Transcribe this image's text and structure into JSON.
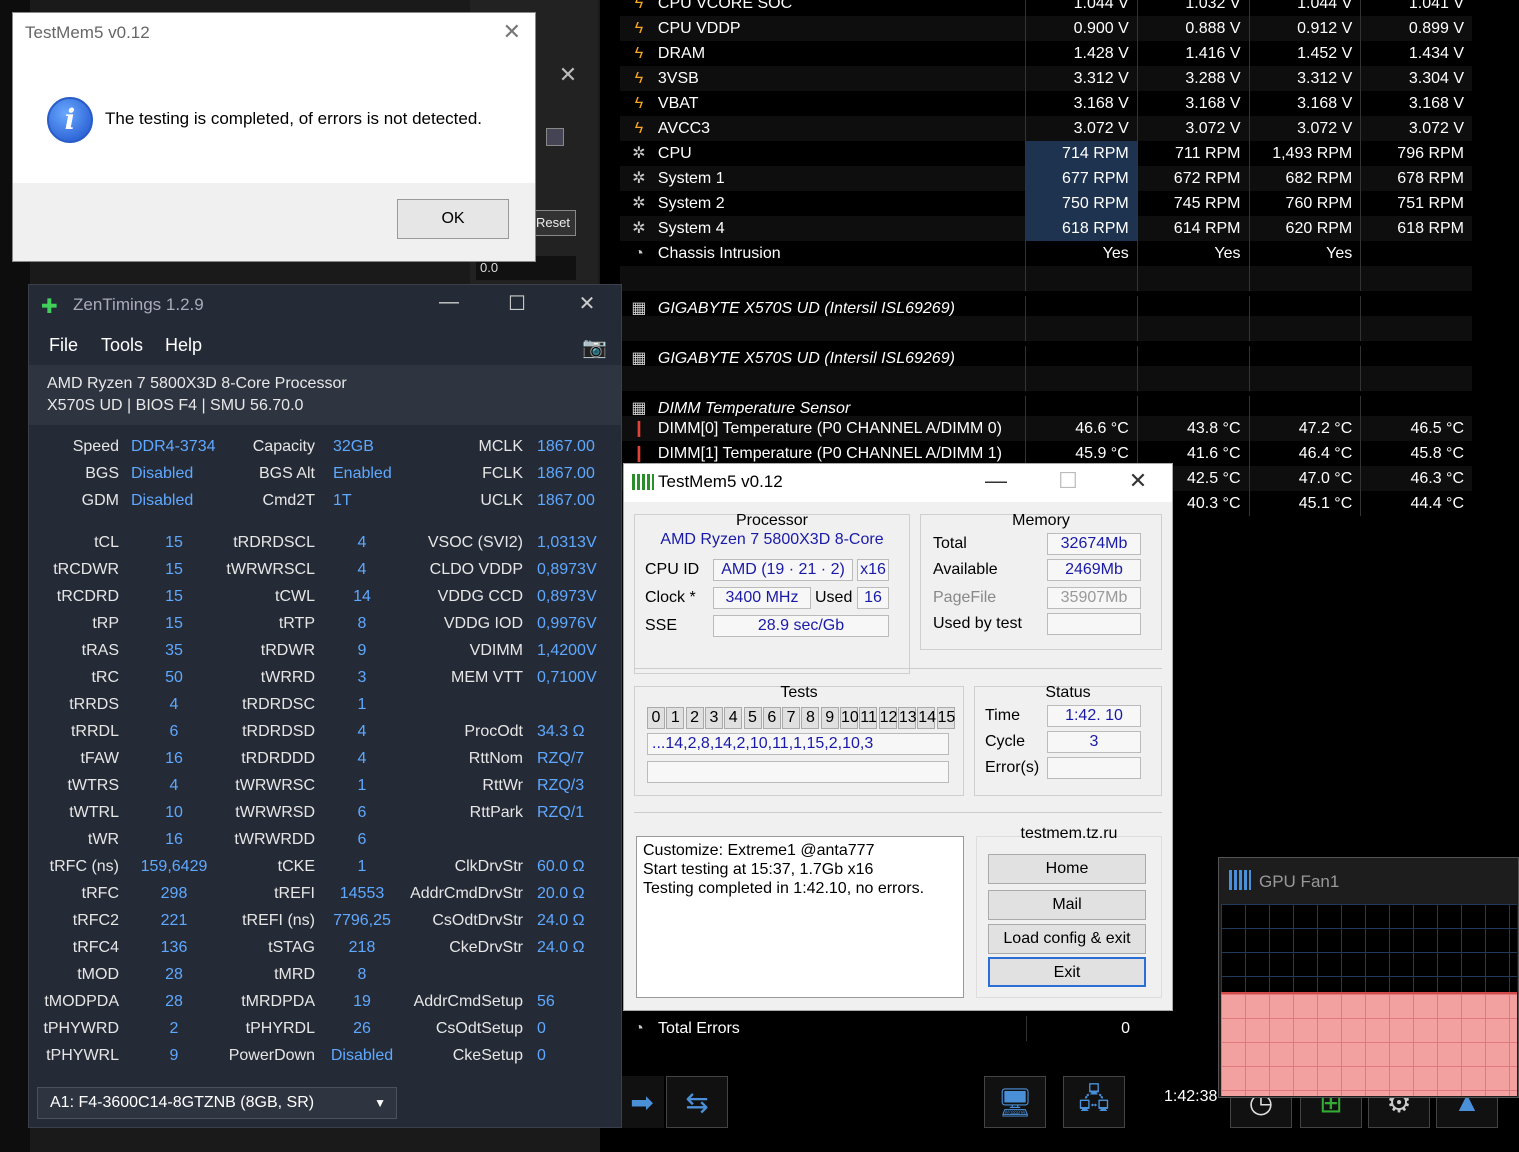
{
  "dialog": {
    "title": "TestMem5 v0.12",
    "message": "The testing is completed, of errors is not detected.",
    "ok_label": "OK"
  },
  "bg_window": {
    "reset_label": "Reset",
    "value": "0.0"
  },
  "sensor": {
    "rows": [
      {
        "icon": "bolt-icon",
        "name": "CPU VCORE SOC",
        "v": [
          "1.044 V",
          "1.032 V",
          "1.044 V",
          "1.041 V"
        ]
      },
      {
        "icon": "bolt-icon",
        "name": "CPU VDDP",
        "v": [
          "0.900 V",
          "0.888 V",
          "0.912 V",
          "0.899 V"
        ]
      },
      {
        "icon": "bolt-icon",
        "name": "DRAM",
        "v": [
          "1.428 V",
          "1.416 V",
          "1.452 V",
          "1.434 V"
        ]
      },
      {
        "icon": "bolt-icon",
        "name": "3VSB",
        "v": [
          "3.312 V",
          "3.288 V",
          "3.312 V",
          "3.304 V"
        ]
      },
      {
        "icon": "bolt-icon",
        "name": "VBAT",
        "v": [
          "3.168 V",
          "3.168 V",
          "3.168 V",
          "3.168 V"
        ]
      },
      {
        "icon": "bolt-icon",
        "name": "AVCC3",
        "v": [
          "3.072 V",
          "3.072 V",
          "3.072 V",
          "3.072 V"
        ]
      },
      {
        "icon": "fan-icon",
        "name": "CPU",
        "v": [
          "714 RPM",
          "711 RPM",
          "1,493 RPM",
          "796 RPM"
        ],
        "hl": true
      },
      {
        "icon": "fan-icon",
        "name": "System 1",
        "v": [
          "677 RPM",
          "672 RPM",
          "682 RPM",
          "678 RPM"
        ],
        "hl": true
      },
      {
        "icon": "fan-icon",
        "name": "System 2",
        "v": [
          "750 RPM",
          "745 RPM",
          "760 RPM",
          "751 RPM"
        ],
        "hl": true
      },
      {
        "icon": "fan-icon",
        "name": "System 4",
        "v": [
          "618 RPM",
          "614 RPM",
          "620 RPM",
          "618 RPM"
        ],
        "hl": true
      },
      {
        "icon": "clock-icon",
        "name": "Chassis Intrusion",
        "v": [
          "Yes",
          "Yes",
          "Yes",
          ""
        ]
      },
      {
        "icon": "",
        "name": "",
        "v": [
          "",
          "",
          "",
          ""
        ]
      },
      {
        "icon": "chip-icon",
        "name": "GIGABYTE X570S UD (Intersil ISL69269)",
        "v": [
          "",
          "",
          "",
          ""
        ],
        "hdr": true
      },
      {
        "icon": "",
        "name": "",
        "v": [
          "",
          "",
          "",
          ""
        ]
      },
      {
        "icon": "chip-icon",
        "name": "GIGABYTE X570S UD (Intersil ISL69269)",
        "v": [
          "",
          "",
          "",
          ""
        ],
        "hdr": true
      },
      {
        "icon": "",
        "name": "",
        "v": [
          "",
          "",
          "",
          ""
        ]
      },
      {
        "icon": "chip-icon",
        "name": "DIMM Temperature Sensor",
        "v": [
          "",
          "",
          "",
          ""
        ],
        "hdr": true
      },
      {
        "icon": "thermo-icon",
        "name": "DIMM[0] Temperature (P0 CHANNEL A/DIMM 0)",
        "v": [
          "46.6 °C",
          "43.8 °C",
          "47.2 °C",
          "46.5 °C"
        ]
      },
      {
        "icon": "thermo-icon",
        "name": "DIMM[1] Temperature (P0 CHANNEL A/DIMM 1)",
        "v": [
          "45.9 °C",
          "41.6 °C",
          "46.4 °C",
          "45.8 °C"
        ]
      },
      {
        "icon": "",
        "name": "",
        "v": [
          "",
          "42.5 °C",
          "47.0 °C",
          "46.3 °C"
        ]
      },
      {
        "icon": "",
        "name": "",
        "v": [
          "",
          "40.3 °C",
          "45.1 °C",
          "44.4 °C"
        ]
      }
    ],
    "total_errors": {
      "name": "Total Errors",
      "value": "0"
    },
    "clock": "1:42:38"
  },
  "zen": {
    "title": "ZenTimings 1.2.9",
    "menu": [
      "File",
      "Tools",
      "Help"
    ],
    "cpu_line1": "AMD Ryzen 7 5800X3D 8-Core Processor",
    "cpu_line2": "X570S UD | BIOS F4 | SMU 56.70.0",
    "rows": [
      [
        "Speed",
        "DDR4-3734",
        "Capacity",
        "32GB",
        "MCLK",
        "1867.00"
      ],
      [
        "BGS",
        "Disabled",
        "BGS Alt",
        "Enabled",
        "FCLK",
        "1867.00"
      ],
      [
        "GDM",
        "Disabled",
        "Cmd2T",
        "1T",
        "UCLK",
        "1867.00"
      ],
      [
        "",
        "",
        "",
        "",
        "",
        ""
      ],
      [
        "tCL",
        "15",
        "tRDRDSCL",
        "4",
        "VSOC (SVI2)",
        "1,0313V"
      ],
      [
        "tRCDWR",
        "15",
        "tWRWRSCL",
        "4",
        "CLDO VDDP",
        "0,8973V"
      ],
      [
        "tRCDRD",
        "15",
        "tCWL",
        "14",
        "VDDG CCD",
        "0,8973V"
      ],
      [
        "tRP",
        "15",
        "tRTP",
        "8",
        "VDDG IOD",
        "0,9976V"
      ],
      [
        "tRAS",
        "35",
        "tRDWR",
        "9",
        "VDIMM",
        "1,4200V"
      ],
      [
        "tRC",
        "50",
        "tWRRD",
        "3",
        "MEM VTT",
        "0,7100V"
      ],
      [
        "tRRDS",
        "4",
        "tRDRDSC",
        "1",
        "",
        ""
      ],
      [
        "tRRDL",
        "6",
        "tRDRDSD",
        "4",
        "ProcOdt",
        "34.3 Ω"
      ],
      [
        "tFAW",
        "16",
        "tRDRDDD",
        "4",
        "RttNom",
        "RZQ/7"
      ],
      [
        "tWTRS",
        "4",
        "tWRWRSC",
        "1",
        "RttWr",
        "RZQ/3"
      ],
      [
        "tWTRL",
        "10",
        "tWRWRSD",
        "6",
        "RttPark",
        "RZQ/1"
      ],
      [
        "tWR",
        "16",
        "tWRWRDD",
        "6",
        "",
        ""
      ],
      [
        "tRFC (ns)",
        "159,6429",
        "tCKE",
        "1",
        "ClkDrvStr",
        "60.0 Ω"
      ],
      [
        "tRFC",
        "298",
        "tREFI",
        "14553",
        "AddrCmdDrvStr",
        "20.0 Ω"
      ],
      [
        "tRFC2",
        "221",
        "tREFI (ns)",
        "7796,25",
        "CsOdtDrvStr",
        "24.0 Ω"
      ],
      [
        "tRFC4",
        "136",
        "tSTAG",
        "218",
        "CkeDrvStr",
        "24.0 Ω"
      ],
      [
        "tMOD",
        "28",
        "tMRD",
        "8",
        "",
        ""
      ],
      [
        "tMODPDA",
        "28",
        "tMRDPDA",
        "19",
        "AddrCmdSetup",
        "56"
      ],
      [
        "tPHYWRD",
        "2",
        "tPHYRDL",
        "26",
        "CsOdtSetup",
        "0"
      ],
      [
        "tPHYWRL",
        "9",
        "PowerDown",
        "Disabled",
        "CkeSetup",
        "0"
      ]
    ],
    "dimm_select": "A1: F4-3600C14-8GTZNB (8GB, SR)"
  },
  "tm": {
    "title": "TestMem5 v0.12",
    "processor_title": "Processor",
    "processor_name": "AMD Ryzen 7 5800X3D 8-Core",
    "cpu_id_label": "CPU ID",
    "cpu_id_value": "AMD  (19 · 21 · 2)",
    "cpu_id_x": "x16",
    "clock_label": "Clock *",
    "clock_value": "3400 MHz",
    "used_label": "Used",
    "used_value": "16",
    "sse_label": "SSE",
    "sse_value": "28.9 sec/Gb",
    "memory_title": "Memory",
    "total_label": "Total",
    "total_value": "32674Mb",
    "available_label": "Available",
    "available_value": "2469Mb",
    "pagefile_label": "PageFile",
    "pagefile_value": "35907Mb",
    "usedbytest_label": "Used by test",
    "usedbytest_value": "",
    "tests_title": "Tests",
    "test_numbers": [
      "0",
      "1",
      "2",
      "3",
      "4",
      "5",
      "6",
      "7",
      "8",
      "9",
      "10",
      "11",
      "12",
      "13",
      "14",
      "15"
    ],
    "test_sequence": "...14,2,8,14,2,10,11,1,15,2,10,3",
    "status_title": "Status",
    "time_label": "Time",
    "time_value": "1:42. 10",
    "cycle_label": "Cycle",
    "cycle_value": "3",
    "errors_label": "Error(s)",
    "errors_value": "",
    "log": [
      "Customize: Extreme1 @anta777",
      "Start testing at 15:37, 1.7Gb x16",
      "Testing completed in 1:42.10, no errors."
    ],
    "site": "testmem.tz.ru",
    "btn_home": "Home",
    "btn_mail": "Mail",
    "btn_load": "Load config & exit",
    "btn_exit": "Exit"
  },
  "gpufan": {
    "title": "GPU Fan1",
    "level": 0.54
  }
}
